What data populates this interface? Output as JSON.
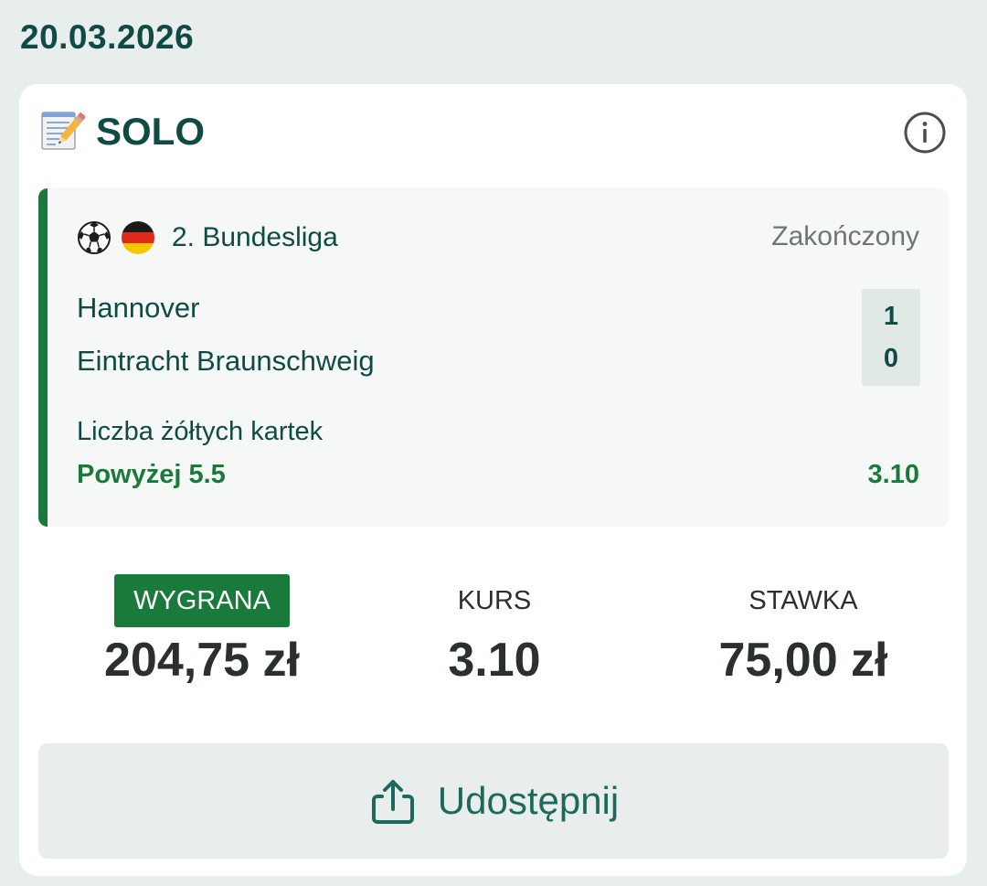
{
  "date": "20.03.2026",
  "bet": {
    "title": "SOLO",
    "icons": {
      "title_icon": "memo-icon",
      "info": "info-icon"
    }
  },
  "match": {
    "sport_icon": "soccer-ball-icon",
    "flag_icon": "germany-flag-icon",
    "league": "2. Bundesliga",
    "status": "Zakończony",
    "home_team": "Hannover",
    "away_team": "Eintracht Braunschweig",
    "home_score": "1",
    "away_score": "0",
    "market": "Liczba żółtych kartek",
    "pick": "Powyżej 5.5",
    "pick_odds": "3.10"
  },
  "summary": {
    "win_label": "WYGRANA",
    "win_value": "204,75 zł",
    "odds_label": "KURS",
    "odds_value": "3.10",
    "stake_label": "STAWKA",
    "stake_value": "75,00 zł"
  },
  "share": {
    "label": "Udostępnij",
    "icon": "share-icon"
  },
  "colors": {
    "background": "#e7eeec",
    "primary_text": "#0f4b44",
    "accent_green": "#1a7a3c",
    "status_gray": "#6e7674",
    "share_text": "#1b6a5c"
  }
}
